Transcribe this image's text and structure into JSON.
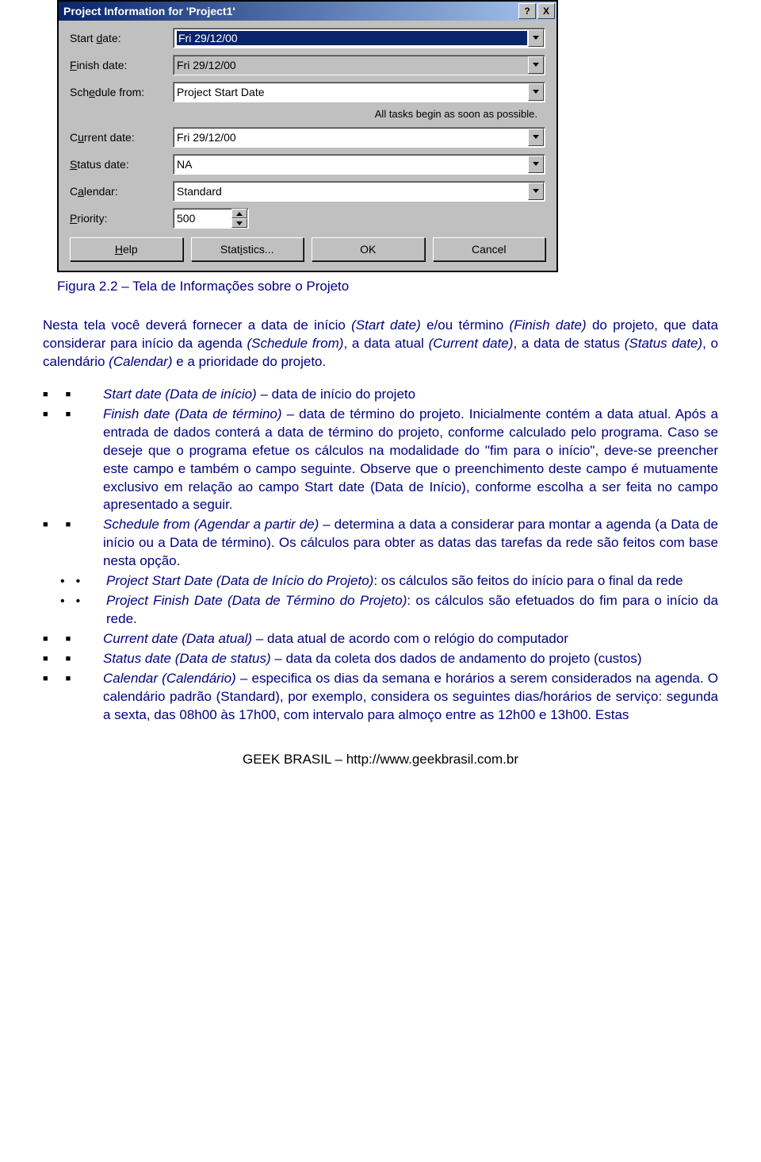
{
  "dialog": {
    "title": "Project Information for 'Project1'",
    "help_glyph": "?",
    "close_glyph": "X",
    "rows": {
      "start_date": {
        "label_html": "Start <u>d</u>ate:",
        "value": "Fri 29/12/00"
      },
      "finish_date": {
        "label_html": "<u>F</u>inish date:",
        "value": "Fri 29/12/00"
      },
      "schedule_from": {
        "label_html": "Sch<u>e</u>dule from:",
        "value": "Project Start Date"
      },
      "current_date": {
        "label_html": "C<u>u</u>rrent date:",
        "value": "Fri 29/12/00"
      },
      "status_date": {
        "label_html": "<u>S</u>tatus date:",
        "value": "NA"
      },
      "calendar": {
        "label_html": "C<u>a</u>lendar:",
        "value": "Standard"
      },
      "priority": {
        "label_html": "<u>P</u>riority:",
        "value": "500"
      }
    },
    "hint": "All tasks begin as soon as possible.",
    "buttons": {
      "help": "Help",
      "stats": "Statistics...",
      "ok": "OK",
      "cancel": "Cancel"
    }
  },
  "caption": "Figura 2.2 – Tela de Informações sobre o Projeto",
  "intro_para": "Nesta tela você deverá fornecer a data de início (Start date) e/ou término (Finish date) do projeto, que data considerar para início da agenda (Schedule from), a data atual (Current date), a data de status (Status date), o calendário (Calendar) e a prioridade do projeto.",
  "items": [
    {
      "level": 1,
      "style": "sq",
      "html": "<span class='italic'>Start date (Data de início)</span> – data de início do projeto"
    },
    {
      "level": 1,
      "style": "sq",
      "html": "<span class='italic'>Finish date (Data de término)</span> – data de término do projeto. Inicialmente contém a data atual. Após a entrada de dados conterá a data de término do projeto, conforme calculado pelo programa. Caso se deseje que o programa efetue os cálculos na modalidade do \"fim para o início\", deve-se preencher este campo e também o campo seguinte. Observe que o preenchimento deste campo é mutuamente exclusivo em relação ao campo Start date (Data de Início), conforme escolha a ser feita no campo apresentado a seguir."
    },
    {
      "level": 1,
      "style": "sq",
      "html": "<span class='italic'>Schedule from (Agendar a partir de)</span> – determina a data a considerar para montar a agenda (a Data de início ou a Data de término). Os cálculos para obter as datas das tarefas da rede são feitos com base nesta opção."
    },
    {
      "level": 2,
      "style": "dot",
      "html": "<span class='italic'>Project Start Date (Data de Início do Projeto)</span>: os cálculos são feitos do início para o final da rede"
    },
    {
      "level": 2,
      "style": "dot",
      "html": "<span class='italic'>Project Finish Date (Data de Término do Projeto)</span>: os cálculos são efetuados do fim para o início da rede."
    },
    {
      "level": 1,
      "style": "sq",
      "html": "<span class='italic'>Current date (Data atual)</span> – data atual de acordo com o relógio do computador"
    },
    {
      "level": 1,
      "style": "sq",
      "html": "<span class='italic'>Status date (Data de status)</span> – data da coleta dos dados de andamento do projeto (custos)"
    },
    {
      "level": 1,
      "style": "sq",
      "html": "<span class='italic'>Calendar (Calendário)</span> – especifica os dias da semana e horários a serem considerados na agenda. O calendário padrão (Standard), por exemplo, considera os seguintes dias/horários de serviço: segunda a sexta, das 08h00 às 17h00, com intervalo para almoço entre as 12h00 e 13h00. Estas"
    }
  ],
  "footer": "GEEK BRASIL – http://www.geekbrasil.com.br"
}
